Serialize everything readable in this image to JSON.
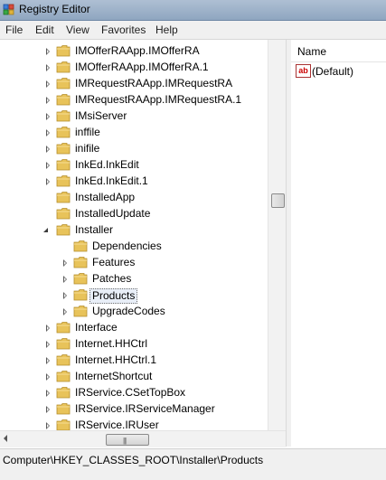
{
  "window": {
    "title": "Registry Editor"
  },
  "menu": [
    "File",
    "Edit",
    "View",
    "Favorites",
    "Help"
  ],
  "tree": {
    "items": [
      {
        "label": "IMOfferRAApp.IMOfferRA",
        "level": 0,
        "expander": "collapsed"
      },
      {
        "label": "IMOfferRAApp.IMOfferRA.1",
        "level": 0,
        "expander": "collapsed"
      },
      {
        "label": "IMRequestRAApp.IMRequestRA",
        "level": 0,
        "expander": "collapsed"
      },
      {
        "label": "IMRequestRAApp.IMRequestRA.1",
        "level": 0,
        "expander": "collapsed"
      },
      {
        "label": "IMsiServer",
        "level": 0,
        "expander": "collapsed"
      },
      {
        "label": "inffile",
        "level": 0,
        "expander": "collapsed"
      },
      {
        "label": "inifile",
        "level": 0,
        "expander": "collapsed"
      },
      {
        "label": "InkEd.InkEdit",
        "level": 0,
        "expander": "collapsed"
      },
      {
        "label": "InkEd.InkEdit.1",
        "level": 0,
        "expander": "collapsed"
      },
      {
        "label": "InstalledApp",
        "level": 0,
        "expander": "none"
      },
      {
        "label": "InstalledUpdate",
        "level": 0,
        "expander": "none"
      },
      {
        "label": "Installer",
        "level": 0,
        "expander": "expanded"
      },
      {
        "label": "Dependencies",
        "level": 1,
        "expander": "none"
      },
      {
        "label": "Features",
        "level": 1,
        "expander": "collapsed"
      },
      {
        "label": "Patches",
        "level": 1,
        "expander": "collapsed"
      },
      {
        "label": "Products",
        "level": 1,
        "expander": "collapsed",
        "selected": true
      },
      {
        "label": "UpgradeCodes",
        "level": 1,
        "expander": "collapsed"
      },
      {
        "label": "Interface",
        "level": 0,
        "expander": "collapsed"
      },
      {
        "label": "Internet.HHCtrl",
        "level": 0,
        "expander": "collapsed"
      },
      {
        "label": "Internet.HHCtrl.1",
        "level": 0,
        "expander": "collapsed"
      },
      {
        "label": "InternetShortcut",
        "level": 0,
        "expander": "collapsed"
      },
      {
        "label": "IRService.CSetTopBox",
        "level": 0,
        "expander": "collapsed"
      },
      {
        "label": "IRService.IRServiceManager",
        "level": 0,
        "expander": "collapsed"
      },
      {
        "label": "IRService.IRUser",
        "level": 0,
        "expander": "collapsed"
      }
    ]
  },
  "list": {
    "column_name": "Name",
    "rows": [
      {
        "name": "(Default)",
        "icon": "string-value-icon"
      }
    ]
  },
  "status": {
    "path": "Computer\\HKEY_CLASSES_ROOT\\Installer\\Products"
  },
  "colors": {
    "folder": "#e8c35a",
    "title_bar": "#a6b8cd",
    "selection": "#e8eef7"
  }
}
